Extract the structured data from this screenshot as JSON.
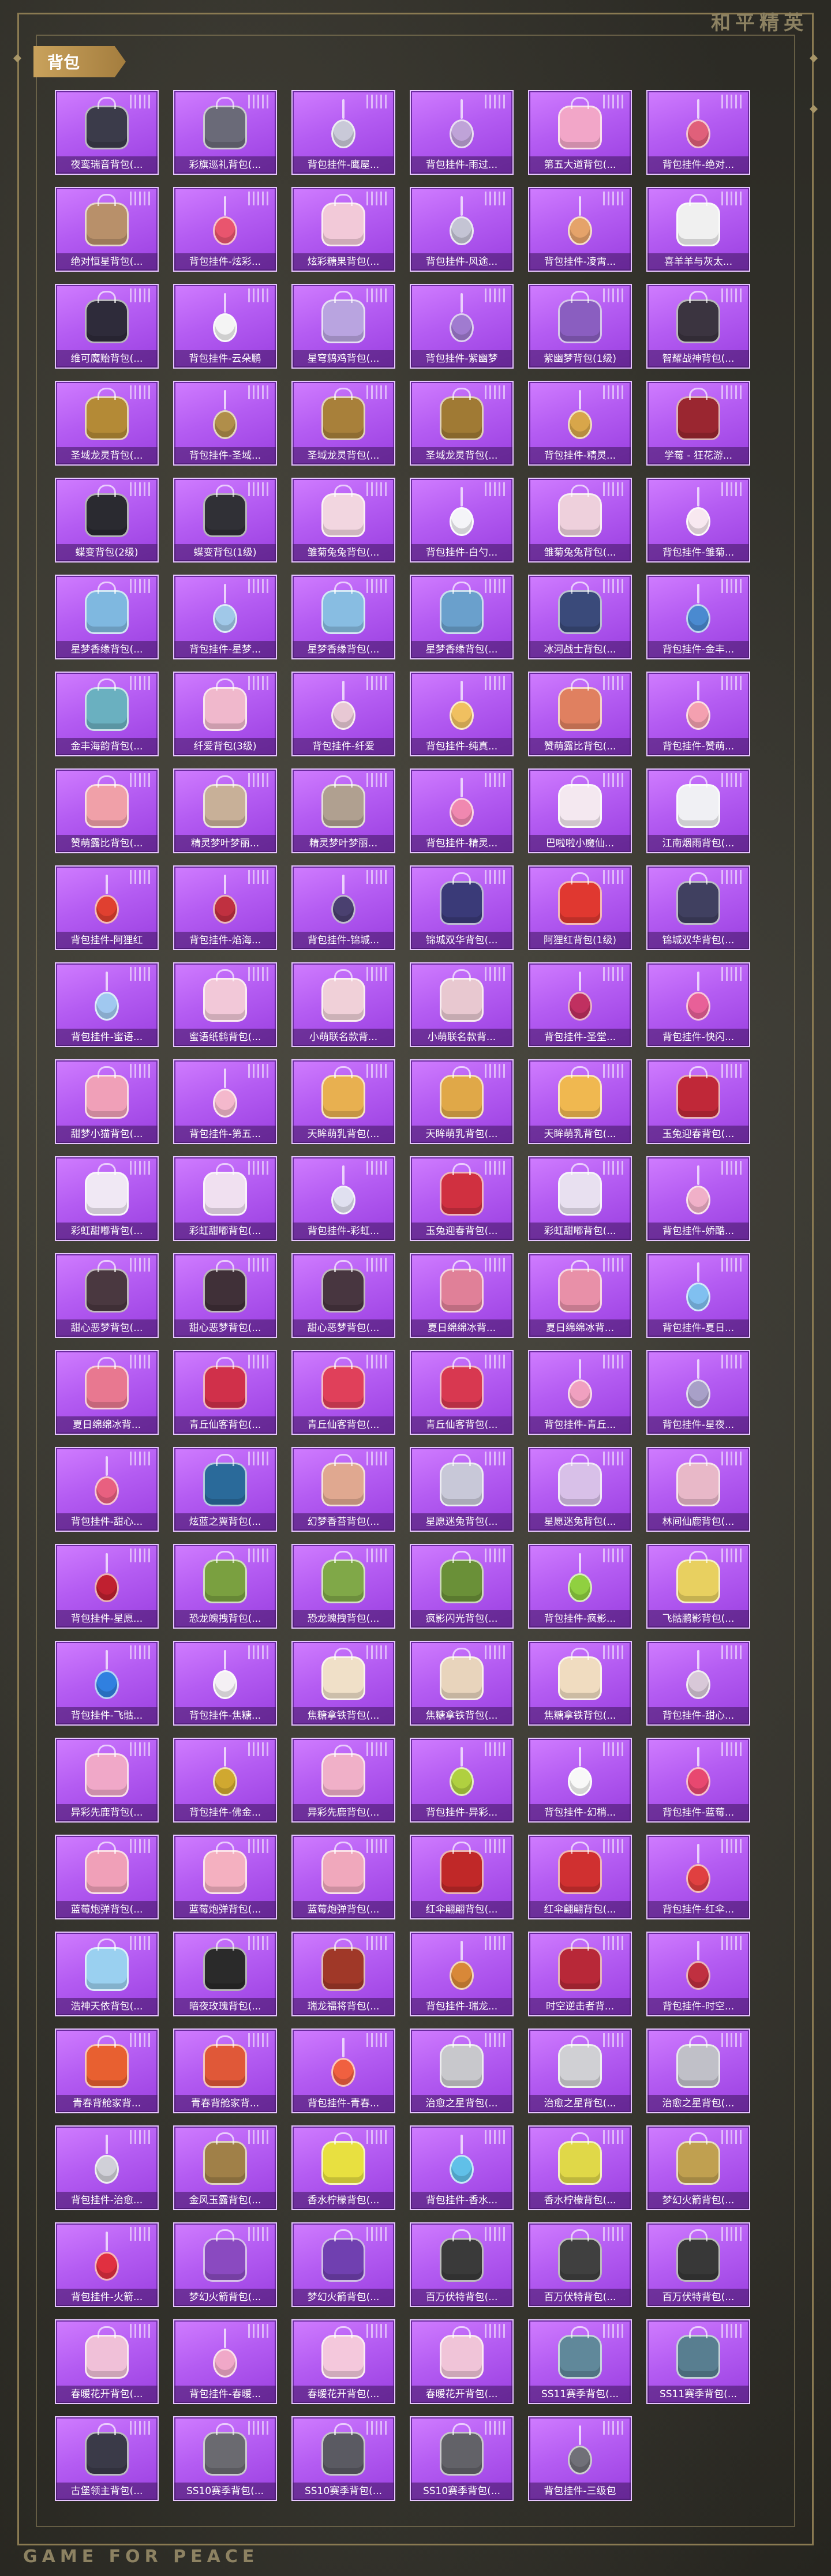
{
  "header": {
    "brand": "和平精英",
    "section_title": "背包"
  },
  "footer": {
    "brand": "GAME FOR PEACE"
  },
  "items": [
    {
      "label": "夜鸾瑞音背包(...",
      "color": "#3b3b4a",
      "kind": "bag"
    },
    {
      "label": "彩旗巡礼背包(...",
      "color": "#6a6a78",
      "kind": "bag"
    },
    {
      "label": "背包挂件-鹰屋...",
      "color": "#c9c9d8",
      "kind": "charm"
    },
    {
      "label": "背包挂件-雨过...",
      "color": "#bfa3d8",
      "kind": "charm"
    },
    {
      "label": "第五大道背包(...",
      "color": "#f2a6c8",
      "kind": "bag"
    },
    {
      "label": "背包挂件-绝对...",
      "color": "#e0607a",
      "kind": "charm"
    },
    {
      "label": "绝对恒星背包(...",
      "color": "#b8906a",
      "kind": "bag"
    },
    {
      "label": "背包挂件-炫彩...",
      "color": "#e9556e",
      "kind": "charm"
    },
    {
      "label": "炫彩糖果背包(...",
      "color": "#f2c9d8",
      "kind": "bag"
    },
    {
      "label": "背包挂件-风途...",
      "color": "#c4c4d4",
      "kind": "charm"
    },
    {
      "label": "背包挂件-凌霄...",
      "color": "#e5a36a",
      "kind": "charm"
    },
    {
      "label": "喜羊羊与灰太...",
      "color": "#f0f0f0",
      "kind": "bag"
    },
    {
      "label": "维可魔贻背包(...",
      "color": "#2e2b3a",
      "kind": "bag"
    },
    {
      "label": "背包挂件-云朵鹏",
      "color": "#f4f4f4",
      "kind": "charm"
    },
    {
      "label": "星穹鸫鸡背包(...",
      "color": "#b9a4e0",
      "kind": "bag"
    },
    {
      "label": "背包挂件-紫幽梦",
      "color": "#a07bd0",
      "kind": "charm"
    },
    {
      "label": "紫幽梦背包(1级)",
      "color": "#8a5ec0",
      "kind": "bag"
    },
    {
      "label": "智耀战神背包(...",
      "color": "#3b3440",
      "kind": "bag"
    },
    {
      "label": "圣域龙灵背包(...",
      "color": "#b48a36",
      "kind": "bag"
    },
    {
      "label": "背包挂件-圣域...",
      "color": "#b08e4a",
      "kind": "charm"
    },
    {
      "label": "圣域龙灵背包(...",
      "color": "#a8803a",
      "kind": "bag"
    },
    {
      "label": "圣域龙灵背包(...",
      "color": "#a07a34",
      "kind": "bag"
    },
    {
      "label": "背包挂件-精灵...",
      "color": "#d8a64a",
      "kind": "charm"
    },
    {
      "label": "学莓 - 狂花游...",
      "color": "#9a2630",
      "kind": "bag"
    },
    {
      "label": "蝶变背包(2级)",
      "color": "#2a2a30",
      "kind": "bag"
    },
    {
      "label": "蝶变背包(1级)",
      "color": "#303036",
      "kind": "bag"
    },
    {
      "label": "雏菊兔兔背包(...",
      "color": "#f2d6e0",
      "kind": "bag"
    },
    {
      "label": "背包挂件-白勺...",
      "color": "#f4f4f8",
      "kind": "charm"
    },
    {
      "label": "雏菊兔兔背包(...",
      "color": "#eed0dc",
      "kind": "bag"
    },
    {
      "label": "背包挂件-雏菊...",
      "color": "#f8e8f0",
      "kind": "charm"
    },
    {
      "label": "星梦香缘背包(...",
      "color": "#7fb8e0",
      "kind": "bag"
    },
    {
      "label": "背包挂件-星梦...",
      "color": "#a0c8e8",
      "kind": "charm"
    },
    {
      "label": "星梦香缘背包(...",
      "color": "#88bde2",
      "kind": "bag"
    },
    {
      "label": "星梦香缘背包(...",
      "color": "#6aa0cc",
      "kind": "bag"
    },
    {
      "label": "冰河战士背包(...",
      "color": "#3a4a7a",
      "kind": "bag"
    },
    {
      "label": "背包挂件-金丰...",
      "color": "#4a8ad0",
      "kind": "charm"
    },
    {
      "label": "金丰海韵背包(...",
      "color": "#6ab0c0",
      "kind": "bag"
    },
    {
      "label": "纤爱背包(3级)",
      "color": "#f0b8cc",
      "kind": "bag"
    },
    {
      "label": "背包挂件-纤爱",
      "color": "#e8c8d4",
      "kind": "charm"
    },
    {
      "label": "背包挂件-纯真...",
      "color": "#f0c060",
      "kind": "charm"
    },
    {
      "label": "赞萌露比背包(...",
      "color": "#e08060",
      "kind": "bag"
    },
    {
      "label": "背包挂件-赞萌...",
      "color": "#f4a0b0",
      "kind": "charm"
    },
    {
      "label": "赞萌露比背包(...",
      "color": "#f0a0a8",
      "kind": "bag"
    },
    {
      "label": "精灵梦叶梦丽...",
      "color": "#c8b098",
      "kind": "bag"
    },
    {
      "label": "精灵梦叶梦丽...",
      "color": "#b0a090",
      "kind": "bag"
    },
    {
      "label": "背包挂件-精灵...",
      "color": "#f088b0",
      "kind": "charm"
    },
    {
      "label": "巴啦啦小魔仙...",
      "color": "#f4e8f0",
      "kind": "bag"
    },
    {
      "label": "江南烟雨背包(...",
      "color": "#f0f0f4",
      "kind": "bag"
    },
    {
      "label": "背包挂件-阿狸红",
      "color": "#e04030",
      "kind": "charm"
    },
    {
      "label": "背包挂件-焰海...",
      "color": "#c03040",
      "kind": "charm"
    },
    {
      "label": "背包挂件-锦城...",
      "color": "#4a4070",
      "kind": "charm"
    },
    {
      "label": "锦城双华背包(...",
      "color": "#3a3a78",
      "kind": "bag"
    },
    {
      "label": "阿狸红背包(1级)",
      "color": "#e03830",
      "kind": "bag"
    },
    {
      "label": "锦城双华背包(...",
      "color": "#404060",
      "kind": "bag"
    },
    {
      "label": "背包挂件-蜜语...",
      "color": "#a0c8f0",
      "kind": "charm"
    },
    {
      "label": "蜜语纸鹤背包(...",
      "color": "#f2c8d8",
      "kind": "bag"
    },
    {
      "label": "小萌联名款背...",
      "color": "#f0d0d8",
      "kind": "bag"
    },
    {
      "label": "小萌联名款背...",
      "color": "#e8c8d0",
      "kind": "bag"
    },
    {
      "label": "背包挂件-圣堂...",
      "color": "#c03060",
      "kind": "charm"
    },
    {
      "label": "背包挂件-快闪...",
      "color": "#e86098",
      "kind": "charm"
    },
    {
      "label": "甜梦小猫背包(...",
      "color": "#f0a0b8",
      "kind": "bag"
    },
    {
      "label": "背包挂件-第五...",
      "color": "#f4b8cc",
      "kind": "charm"
    },
    {
      "label": "天眸萌乳背包(...",
      "color": "#e8b050",
      "kind": "bag"
    },
    {
      "label": "天眸萌乳背包(...",
      "color": "#e0a848",
      "kind": "bag"
    },
    {
      "label": "天眸萌乳背包(...",
      "color": "#f0b850",
      "kind": "bag"
    },
    {
      "label": "玉兔迎春背包(...",
      "color": "#c02838",
      "kind": "bag"
    },
    {
      "label": "彩虹甜嘟背包(...",
      "color": "#f0e8f4",
      "kind": "bag"
    },
    {
      "label": "彩虹甜嘟背包(...",
      "color": "#f0e0f0",
      "kind": "bag"
    },
    {
      "label": "背包挂件-彩虹...",
      "color": "#e0e0f0",
      "kind": "charm"
    },
    {
      "label": "玉兔迎春背包(...",
      "color": "#d03040",
      "kind": "bag"
    },
    {
      "label": "彩虹甜嘟背包(...",
      "color": "#e8e0f0",
      "kind": "bag"
    },
    {
      "label": "背包挂件-娇酷...",
      "color": "#f0b0c8",
      "kind": "charm"
    },
    {
      "label": "甜心恶梦背包(...",
      "color": "#4a3840",
      "kind": "bag"
    },
    {
      "label": "甜心恶梦背包(...",
      "color": "#403038",
      "kind": "bag"
    },
    {
      "label": "甜心恶梦背包(...",
      "color": "#483640",
      "kind": "bag"
    },
    {
      "label": "夏日绵绵冰背...",
      "color": "#e08098",
      "kind": "bag"
    },
    {
      "label": "夏日绵绵冰背...",
      "color": "#e890a8",
      "kind": "bag"
    },
    {
      "label": "背包挂件-夏日...",
      "color": "#80c0f0",
      "kind": "charm"
    },
    {
      "label": "夏日绵绵冰背...",
      "color": "#e87890",
      "kind": "bag"
    },
    {
      "label": "青丘仙客背包(...",
      "color": "#d0304a",
      "kind": "bag"
    },
    {
      "label": "青丘仙客背包(...",
      "color": "#e0405a",
      "kind": "bag"
    },
    {
      "label": "青丘仙客背包(...",
      "color": "#d83850",
      "kind": "bag"
    },
    {
      "label": "背包挂件-青丘...",
      "color": "#f0a0c0",
      "kind": "charm"
    },
    {
      "label": "背包挂件-星夜...",
      "color": "#a8a0c8",
      "kind": "charm"
    },
    {
      "label": "背包挂件-甜心...",
      "color": "#e86080",
      "kind": "charm"
    },
    {
      "label": "炫蓝之翼背包(...",
      "color": "#2a6a9a",
      "kind": "bag"
    },
    {
      "label": "幻梦香苔背包(...",
      "color": "#e0a890",
      "kind": "bag"
    },
    {
      "label": "星愿迷兔背包(...",
      "color": "#c8c8d8",
      "kind": "bag"
    },
    {
      "label": "星愿迷兔背包(...",
      "color": "#d8c0e8",
      "kind": "bag"
    },
    {
      "label": "林间仙鹿背包(...",
      "color": "#e8b8c8",
      "kind": "bag"
    },
    {
      "label": "背包挂件-星愿...",
      "color": "#c02030",
      "kind": "charm"
    },
    {
      "label": "恐龙魄拽背包(...",
      "color": "#7aa040",
      "kind": "bag"
    },
    {
      "label": "恐龙魄拽背包(...",
      "color": "#80a848",
      "kind": "bag"
    },
    {
      "label": "疯影闪光背包(...",
      "color": "#6a9038",
      "kind": "bag"
    },
    {
      "label": "背包挂件-疯影...",
      "color": "#90d040",
      "kind": "charm"
    },
    {
      "label": "飞骷鹏影背包(...",
      "color": "#e8d060",
      "kind": "bag"
    },
    {
      "label": "背包挂件-飞骷...",
      "color": "#3080e0",
      "kind": "charm"
    },
    {
      "label": "背包挂件-焦糖...",
      "color": "#f4f0f4",
      "kind": "charm"
    },
    {
      "label": "焦糖拿铁背包(...",
      "color": "#f0e0c8",
      "kind": "bag"
    },
    {
      "label": "焦糖拿铁背包(...",
      "color": "#e8d4bc",
      "kind": "bag"
    },
    {
      "label": "焦糖拿铁背包(...",
      "color": "#f0dcc0",
      "kind": "bag"
    },
    {
      "label": "背包挂件-甜心...",
      "color": "#d8c8d8",
      "kind": "charm"
    },
    {
      "label": "异彩先鹿背包(...",
      "color": "#f0a8c8",
      "kind": "bag"
    },
    {
      "label": "背包挂件-佛金...",
      "color": "#d0a830",
      "kind": "charm"
    },
    {
      "label": "异彩先鹿背包(...",
      "color": "#f0b0c8",
      "kind": "bag"
    },
    {
      "label": "背包挂件-异彩...",
      "color": "#b0d040",
      "kind": "charm"
    },
    {
      "label": "背包挂件-幻梢...",
      "color": "#f8f8f8",
      "kind": "charm"
    },
    {
      "label": "背包挂件-蓝莓...",
      "color": "#e84870",
      "kind": "charm"
    },
    {
      "label": "蓝莓炮弹背包(...",
      "color": "#f0a0b8",
      "kind": "bag"
    },
    {
      "label": "蓝莓炮弹背包(...",
      "color": "#f4b0c0",
      "kind": "bag"
    },
    {
      "label": "蓝莓炮弹背包(...",
      "color": "#f0a8bc",
      "kind": "bag"
    },
    {
      "label": "红伞翩翩背包(...",
      "color": "#c02828",
      "kind": "bag"
    },
    {
      "label": "红伞翩翩背包(...",
      "color": "#d03030",
      "kind": "bag"
    },
    {
      "label": "背包挂件-红伞...",
      "color": "#e04040",
      "kind": "charm"
    },
    {
      "label": "浩神天依背包(...",
      "color": "#9ad0f0",
      "kind": "bag"
    },
    {
      "label": "暗夜玫瑰背包(...",
      "color": "#2a2a2a",
      "kind": "bag"
    },
    {
      "label": "瑞龙福将背包(...",
      "color": "#a03828",
      "kind": "bag"
    },
    {
      "label": "背包挂件-瑞龙...",
      "color": "#d88838",
      "kind": "charm"
    },
    {
      "label": "时空逆击者背...",
      "color": "#b82838",
      "kind": "bag"
    },
    {
      "label": "背包挂件-时空...",
      "color": "#c03040",
      "kind": "charm"
    },
    {
      "label": "青春背舱家背...",
      "color": "#e86030",
      "kind": "bag"
    },
    {
      "label": "青春背舱家背...",
      "color": "#e05838",
      "kind": "bag"
    },
    {
      "label": "背包挂件-青春...",
      "color": "#f06040",
      "kind": "charm"
    },
    {
      "label": "治愈之星背包(...",
      "color": "#c8c8cc",
      "kind": "bag"
    },
    {
      "label": "治愈之星背包(...",
      "color": "#d0d0d4",
      "kind": "bag"
    },
    {
      "label": "治愈之星背包(...",
      "color": "#c0c0c8",
      "kind": "bag"
    },
    {
      "label": "背包挂件-治愈...",
      "color": "#d0d0d8",
      "kind": "charm"
    },
    {
      "label": "金风玉露背包(...",
      "color": "#a08048",
      "kind": "bag"
    },
    {
      "label": "香水柠檬背包(...",
      "color": "#e8e040",
      "kind": "bag"
    },
    {
      "label": "背包挂件-香水...",
      "color": "#60c0e8",
      "kind": "charm"
    },
    {
      "label": "香水柠檬背包(...",
      "color": "#e0d848",
      "kind": "bag"
    },
    {
      "label": "梦幻火箭背包(...",
      "color": "#c0a050",
      "kind": "bag"
    },
    {
      "label": "背包挂件-火箭...",
      "color": "#e03040",
      "kind": "charm"
    },
    {
      "label": "梦幻火箭背包(...",
      "color": "#8a4ac0",
      "kind": "bag"
    },
    {
      "label": "梦幻火箭背包(...",
      "color": "#7040b0",
      "kind": "bag"
    },
    {
      "label": "百万伏特背包(...",
      "color": "#3a3a3a",
      "kind": "bag"
    },
    {
      "label": "百万伏特背包(...",
      "color": "#404040",
      "kind": "bag"
    },
    {
      "label": "百万伏特背包(...",
      "color": "#383838",
      "kind": "bag"
    },
    {
      "label": "春暖花开背包(...",
      "color": "#f0c0d8",
      "kind": "bag"
    },
    {
      "label": "背包挂件-春暖...",
      "color": "#f0a8c8",
      "kind": "charm"
    },
    {
      "label": "春暖花开背包(...",
      "color": "#f4c8dc",
      "kind": "bag"
    },
    {
      "label": "春暖花开背包(...",
      "color": "#f0c4d8",
      "kind": "bag"
    },
    {
      "label": "SS11赛季背包(...",
      "color": "#60889a",
      "kind": "bag"
    },
    {
      "label": "SS11赛季背包(...",
      "color": "#587e90",
      "kind": "bag"
    },
    {
      "label": "古堡领主背包(...",
      "color": "#3a3a48",
      "kind": "bag"
    },
    {
      "label": "SS10赛季背包(...",
      "color": "#6a6a70",
      "kind": "bag"
    },
    {
      "label": "SS10赛季背包(...",
      "color": "#5a5a62",
      "kind": "bag"
    },
    {
      "label": "SS10赛季背包(...",
      "color": "#626268",
      "kind": "bag"
    },
    {
      "label": "背包挂件-三级包",
      "color": "#707078",
      "kind": "charm"
    }
  ]
}
